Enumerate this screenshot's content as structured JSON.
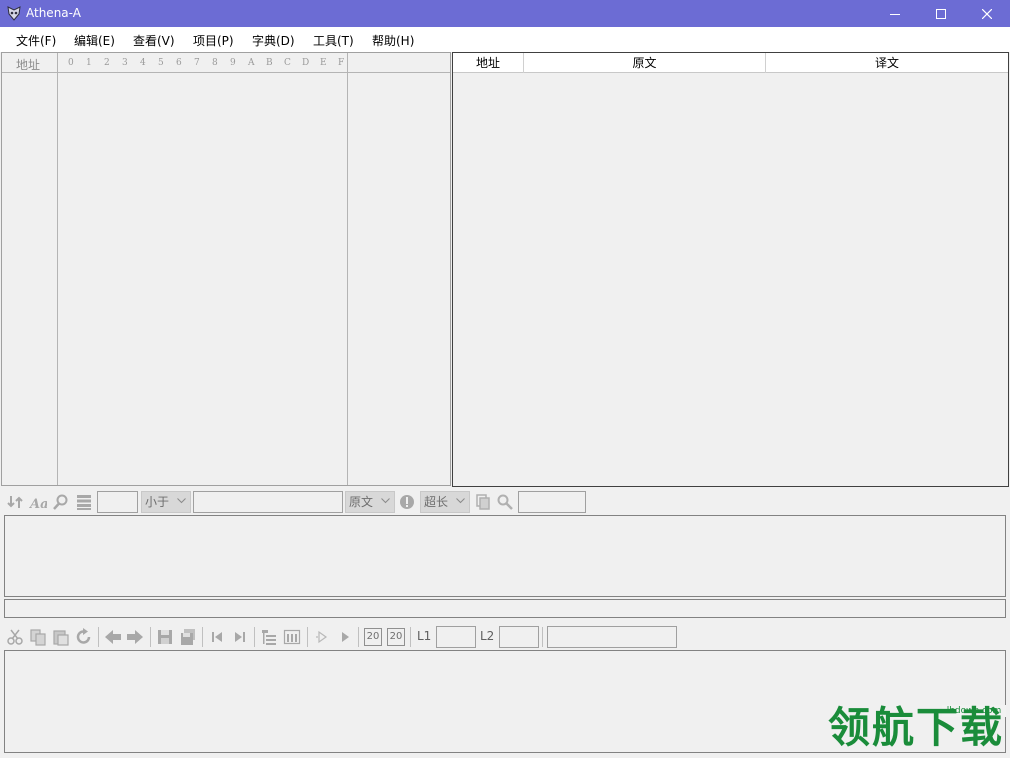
{
  "window": {
    "title": "Athena-A",
    "titlebar_color": "#6c6cd4"
  },
  "menu": [
    {
      "label": "文件(F)"
    },
    {
      "label": "编辑(E)"
    },
    {
      "label": "查看(V)"
    },
    {
      "label": "项目(P)"
    },
    {
      "label": "字典(D)"
    },
    {
      "label": "工具(T)"
    },
    {
      "label": "帮助(H)"
    }
  ],
  "hex_view": {
    "address_header": "地址",
    "digits": [
      "0",
      "1",
      "2",
      "3",
      "4",
      "5",
      "6",
      "7",
      "8",
      "9",
      "A",
      "B",
      "C",
      "D",
      "E",
      "F"
    ]
  },
  "translation_table": {
    "columns": [
      "地址",
      "原文",
      "译文"
    ]
  },
  "search_toolbar": {
    "compare_select": "小于",
    "field_select": "原文",
    "length_select": "超长"
  },
  "edit_toolbar": {
    "l1_label": "L1",
    "l2_label": "L2",
    "badge_a": "20",
    "badge_b": "20"
  },
  "watermark": {
    "site": "lhdown.com",
    "text": "领航下载"
  },
  "icons": {
    "app": "athena-app-icon",
    "minimize": "minimize-icon",
    "maximize": "maximize-icon",
    "close": "close-icon",
    "search_row": [
      "refresh-icon",
      "font-icon",
      "search-icon",
      "list-icon",
      "info-icon",
      "copy-icon",
      "find-icon"
    ],
    "edit_row": [
      "cut-icon",
      "copy-icon",
      "paste-icon",
      "redo-icon",
      "arrow-left-icon",
      "arrow-right-icon",
      "save-icon",
      "save-all-icon",
      "first-icon",
      "last-icon",
      "tree-icon",
      "columns-icon",
      "play-outline-icon",
      "play-icon"
    ]
  }
}
